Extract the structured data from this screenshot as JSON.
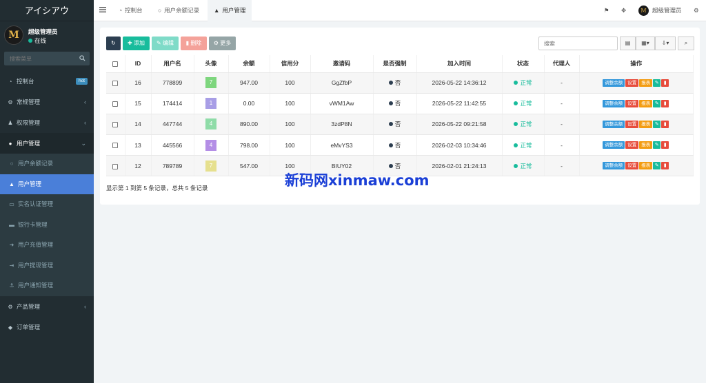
{
  "app": {
    "brand": "アイシアウ"
  },
  "user": {
    "name": "超级管理员",
    "status": "在线",
    "avatar_letter": "M"
  },
  "sidebar": {
    "search_placeholder": "搜索菜单",
    "items": [
      {
        "label": "控制台",
        "icon": "dashboard-icon",
        "badge": "hot"
      },
      {
        "label": "常规管理",
        "icon": "cogs-icon"
      },
      {
        "label": "权限管理",
        "icon": "users-icon"
      },
      {
        "label": "用户管理",
        "icon": "user-circle-icon"
      }
    ],
    "sub_items": [
      {
        "label": "用户余额记录",
        "icon": "circle-icon"
      },
      {
        "label": "用户管理",
        "icon": "user-icon"
      },
      {
        "label": "实名认证管理",
        "icon": "id-card-icon"
      },
      {
        "label": "银行卡管理",
        "icon": "credit-card-icon"
      },
      {
        "label": "用户充值管理",
        "icon": "sign-in-icon"
      },
      {
        "label": "用户提现管理",
        "icon": "sign-out-icon"
      },
      {
        "label": "用户通知管理",
        "icon": "anchor-icon"
      }
    ],
    "bottom_items": [
      {
        "label": "产品管理",
        "icon": "gear-icon"
      },
      {
        "label": "订单管理",
        "icon": "diamond-icon"
      }
    ]
  },
  "topbar": {
    "tabs": [
      {
        "label": "控制台",
        "icon": "dashboard-icon"
      },
      {
        "label": "用户余额记录",
        "icon": "circle-icon"
      },
      {
        "label": "用户管理",
        "icon": "user-icon"
      }
    ],
    "admin_name": "超级管理员"
  },
  "toolbar": {
    "add": "添加",
    "edit": "编辑",
    "delete": "删除",
    "more": "更多",
    "search_placeholder": "搜索"
  },
  "table": {
    "headers": [
      "ID",
      "用户名",
      "头像",
      "余额",
      "信用分",
      "邀请码",
      "是否强制",
      "加入时间",
      "状态",
      "代理人",
      "操作"
    ],
    "rows": [
      {
        "id": "16",
        "username": "778899",
        "avatar": "7",
        "avatar_color": "#7ed67e",
        "balance": "947.00",
        "credit": "100",
        "code": "GgZfbP",
        "force": "否",
        "joined": "2026-05-22 14:36:12",
        "status": "正常",
        "agent": "-"
      },
      {
        "id": "15",
        "username": "174414",
        "avatar": "1",
        "avatar_color": "#a89ee6",
        "balance": "0.00",
        "credit": "100",
        "code": "vWM1Aw",
        "force": "否",
        "joined": "2026-05-22 11:42:55",
        "status": "正常",
        "agent": "-"
      },
      {
        "id": "14",
        "username": "447744",
        "avatar": "4",
        "avatar_color": "#8fdca8",
        "balance": "890.00",
        "credit": "100",
        "code": "3zdP8N",
        "force": "否",
        "joined": "2026-05-22 09:21:58",
        "status": "正常",
        "agent": "-"
      },
      {
        "id": "13",
        "username": "445566",
        "avatar": "4",
        "avatar_color": "#b48ee6",
        "balance": "798.00",
        "credit": "100",
        "code": "eMvYS3",
        "force": "否",
        "joined": "2026-02-03 10:34:46",
        "status": "正常",
        "agent": "-"
      },
      {
        "id": "12",
        "username": "789789",
        "avatar": "7",
        "avatar_color": "#e6e08e",
        "balance": "547.00",
        "credit": "100",
        "code": "BIUY02",
        "force": "否",
        "joined": "2026-02-01 21:24:13",
        "status": "正常",
        "agent": "-"
      }
    ],
    "ops": {
      "adjust": "调整余额",
      "setting": "设置",
      "report": "报表"
    }
  },
  "footer": "显示第 1 到第 5 条记录，总共 5 条记录",
  "watermark": "新码网xinmaw.com",
  "colors": {
    "sidebar_bg": "#222d32",
    "active": "#4a7fd9",
    "success": "#18bc9c",
    "danger": "#e74c3c",
    "warning": "#f39c12",
    "info": "#3498db"
  }
}
